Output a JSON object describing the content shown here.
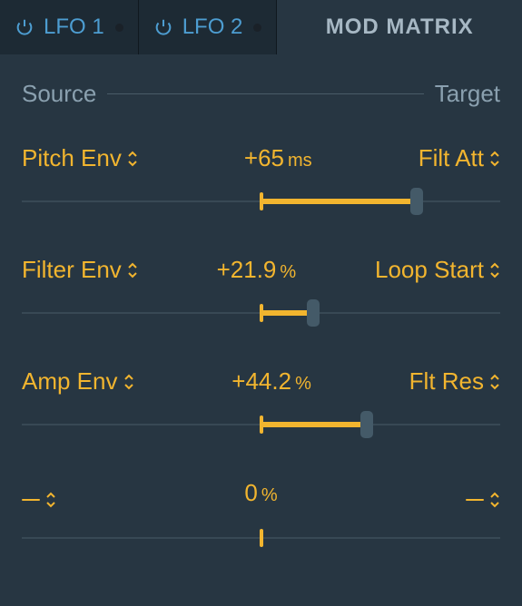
{
  "tabs": {
    "lfo1": "LFO 1",
    "lfo2": "LFO 2",
    "modmatrix": "MOD MATRIX"
  },
  "header": {
    "source": "Source",
    "target": "Target"
  },
  "rows": [
    {
      "source": "Pitch Env",
      "value": "+65",
      "unit": "ms",
      "target": "Filt Att",
      "pct": 65
    },
    {
      "source": "Filter Env",
      "value": "+21.9",
      "unit": "%",
      "target": "Loop Start",
      "pct": 21.9
    },
    {
      "source": "Amp Env",
      "value": "+44.2",
      "unit": "%",
      "target": "Flt Res",
      "pct": 44.2
    },
    {
      "source": "",
      "value": "0",
      "unit": "%",
      "target": "",
      "pct": 0
    }
  ]
}
